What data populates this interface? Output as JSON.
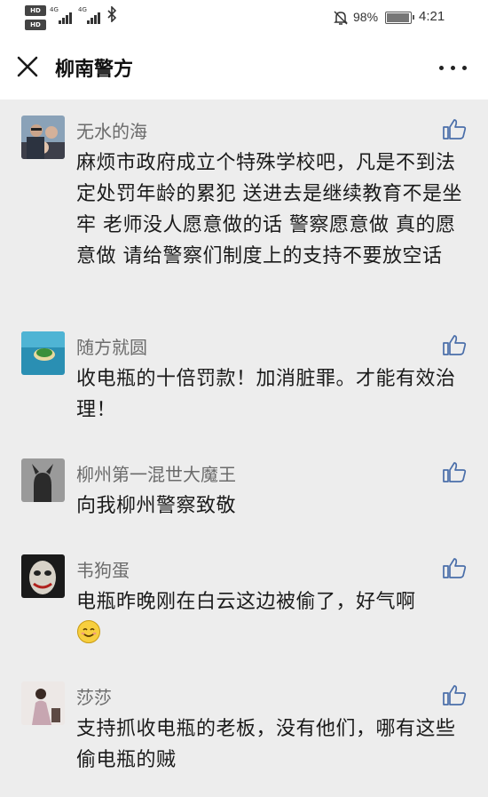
{
  "status_bar": {
    "hd_label_1": "HD",
    "hd_label_2": "HD",
    "net_1": "4G",
    "net_2": "4G",
    "battery_percent": "98%",
    "time": "4:21",
    "icons": [
      "hd-icon",
      "signal-icon",
      "bluetooth-icon",
      "mute-icon",
      "battery-icon"
    ]
  },
  "header": {
    "title": "柳南警方",
    "close_icon": "close-icon",
    "more_icon": "more-icon"
  },
  "comments": [
    {
      "name": "无水的海",
      "text": "麻烦市政府成立个特殊学校吧，凡是不到法定处罚年龄的累犯 送进去是继续教育不是坐牢 老师没人愿意做的话 警察愿意做 真的愿意做 请给警察们制度上的支持不要放空话"
    },
    {
      "name": "随方就圆",
      "text": "收电瓶的十倍罚款！加消脏罪。才能有效治理！"
    },
    {
      "name": "柳州第一混世大魔王",
      "text": "向我柳州警察致敬"
    },
    {
      "name": "韦狗蛋",
      "text": "电瓶昨晚刚在白云这边被偷了，好气啊",
      "emoji": "smile-emoji"
    },
    {
      "name": "莎莎",
      "text": "支持抓收电瓶的老板，没有他们，哪有这些偷电瓶的贼"
    }
  ],
  "colors": {
    "background": "#ededed",
    "header_bg": "#ffffff",
    "name_gray": "#6b6b6b",
    "like_icon": "#4a6ea9"
  }
}
